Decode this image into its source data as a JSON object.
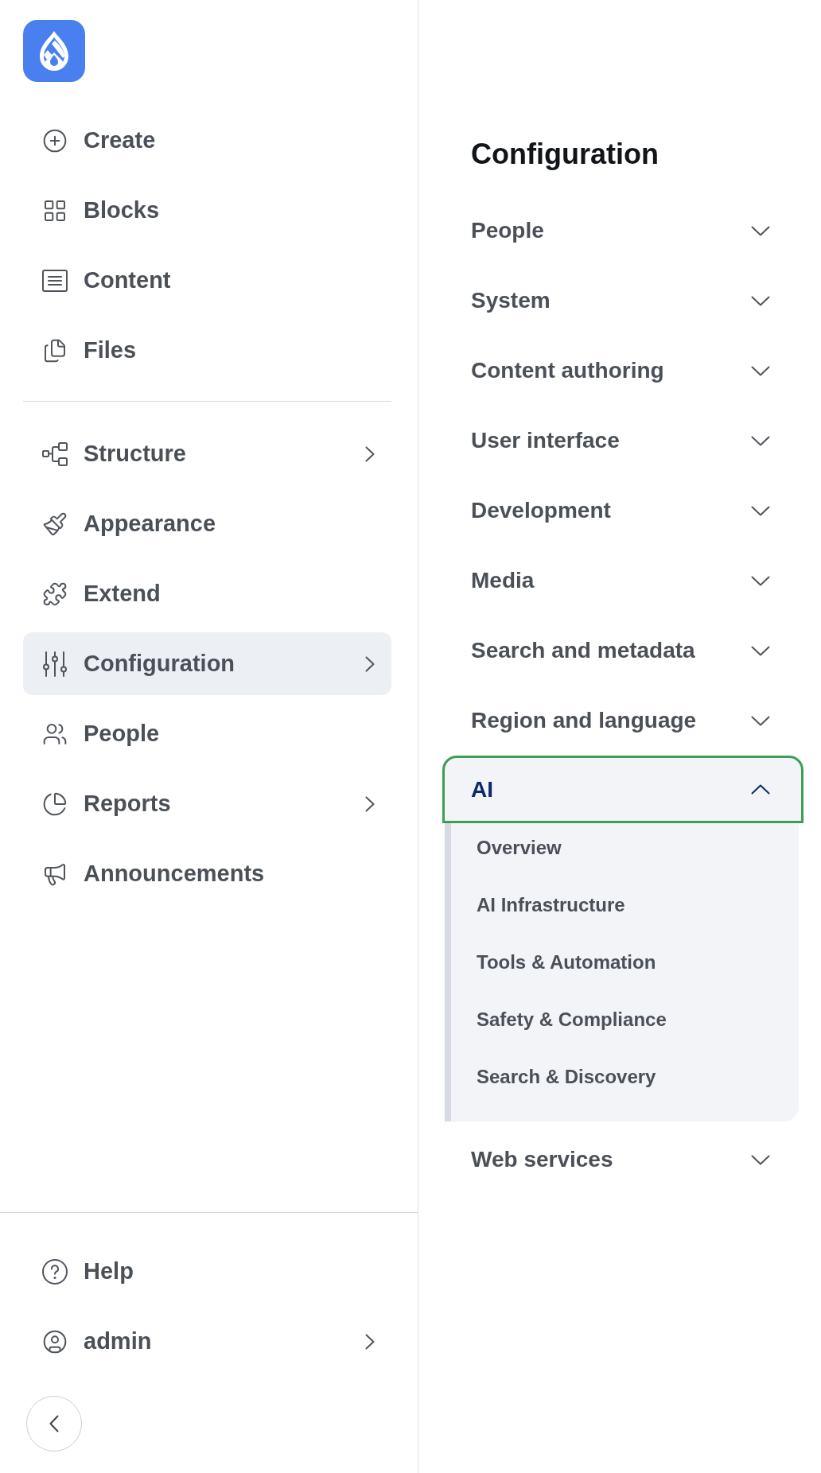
{
  "sidebar": {
    "primary_items": [
      {
        "label": "Create",
        "selected": false,
        "expandable": false
      },
      {
        "label": "Blocks",
        "selected": false,
        "expandable": false
      },
      {
        "label": "Content",
        "selected": false,
        "expandable": false
      },
      {
        "label": "Files",
        "selected": false,
        "expandable": false
      }
    ],
    "secondary_items": [
      {
        "label": "Structure",
        "selected": false,
        "expandable": true
      },
      {
        "label": "Appearance",
        "selected": false,
        "expandable": false
      },
      {
        "label": "Extend",
        "selected": false,
        "expandable": false
      },
      {
        "label": "Configuration",
        "selected": true,
        "expandable": true
      },
      {
        "label": "People",
        "selected": false,
        "expandable": false
      },
      {
        "label": "Reports",
        "selected": false,
        "expandable": true
      },
      {
        "label": "Announcements",
        "selected": false,
        "expandable": false
      }
    ],
    "footer_items": [
      {
        "label": "Help",
        "selected": false,
        "expandable": false
      },
      {
        "label": "admin",
        "selected": false,
        "expandable": true
      }
    ]
  },
  "panel": {
    "title": "Configuration",
    "sections": [
      {
        "label": "People",
        "expanded": false,
        "focused": false
      },
      {
        "label": "System",
        "expanded": false,
        "focused": false
      },
      {
        "label": "Content authoring",
        "expanded": false,
        "focused": false
      },
      {
        "label": "User interface",
        "expanded": false,
        "focused": false
      },
      {
        "label": "Development",
        "expanded": false,
        "focused": false
      },
      {
        "label": "Media",
        "expanded": false,
        "focused": false
      },
      {
        "label": "Search and metadata",
        "expanded": false,
        "focused": false
      },
      {
        "label": "Region and language",
        "expanded": false,
        "focused": false
      },
      {
        "label": "AI",
        "expanded": true,
        "focused": true,
        "children": [
          {
            "label": "Overview"
          },
          {
            "label": "AI Infrastructure"
          },
          {
            "label": "Tools & Automation"
          },
          {
            "label": "Safety & Compliance"
          },
          {
            "label": "Search & Discovery"
          }
        ]
      },
      {
        "label": "Web services",
        "expanded": false,
        "focused": false
      }
    ]
  }
}
